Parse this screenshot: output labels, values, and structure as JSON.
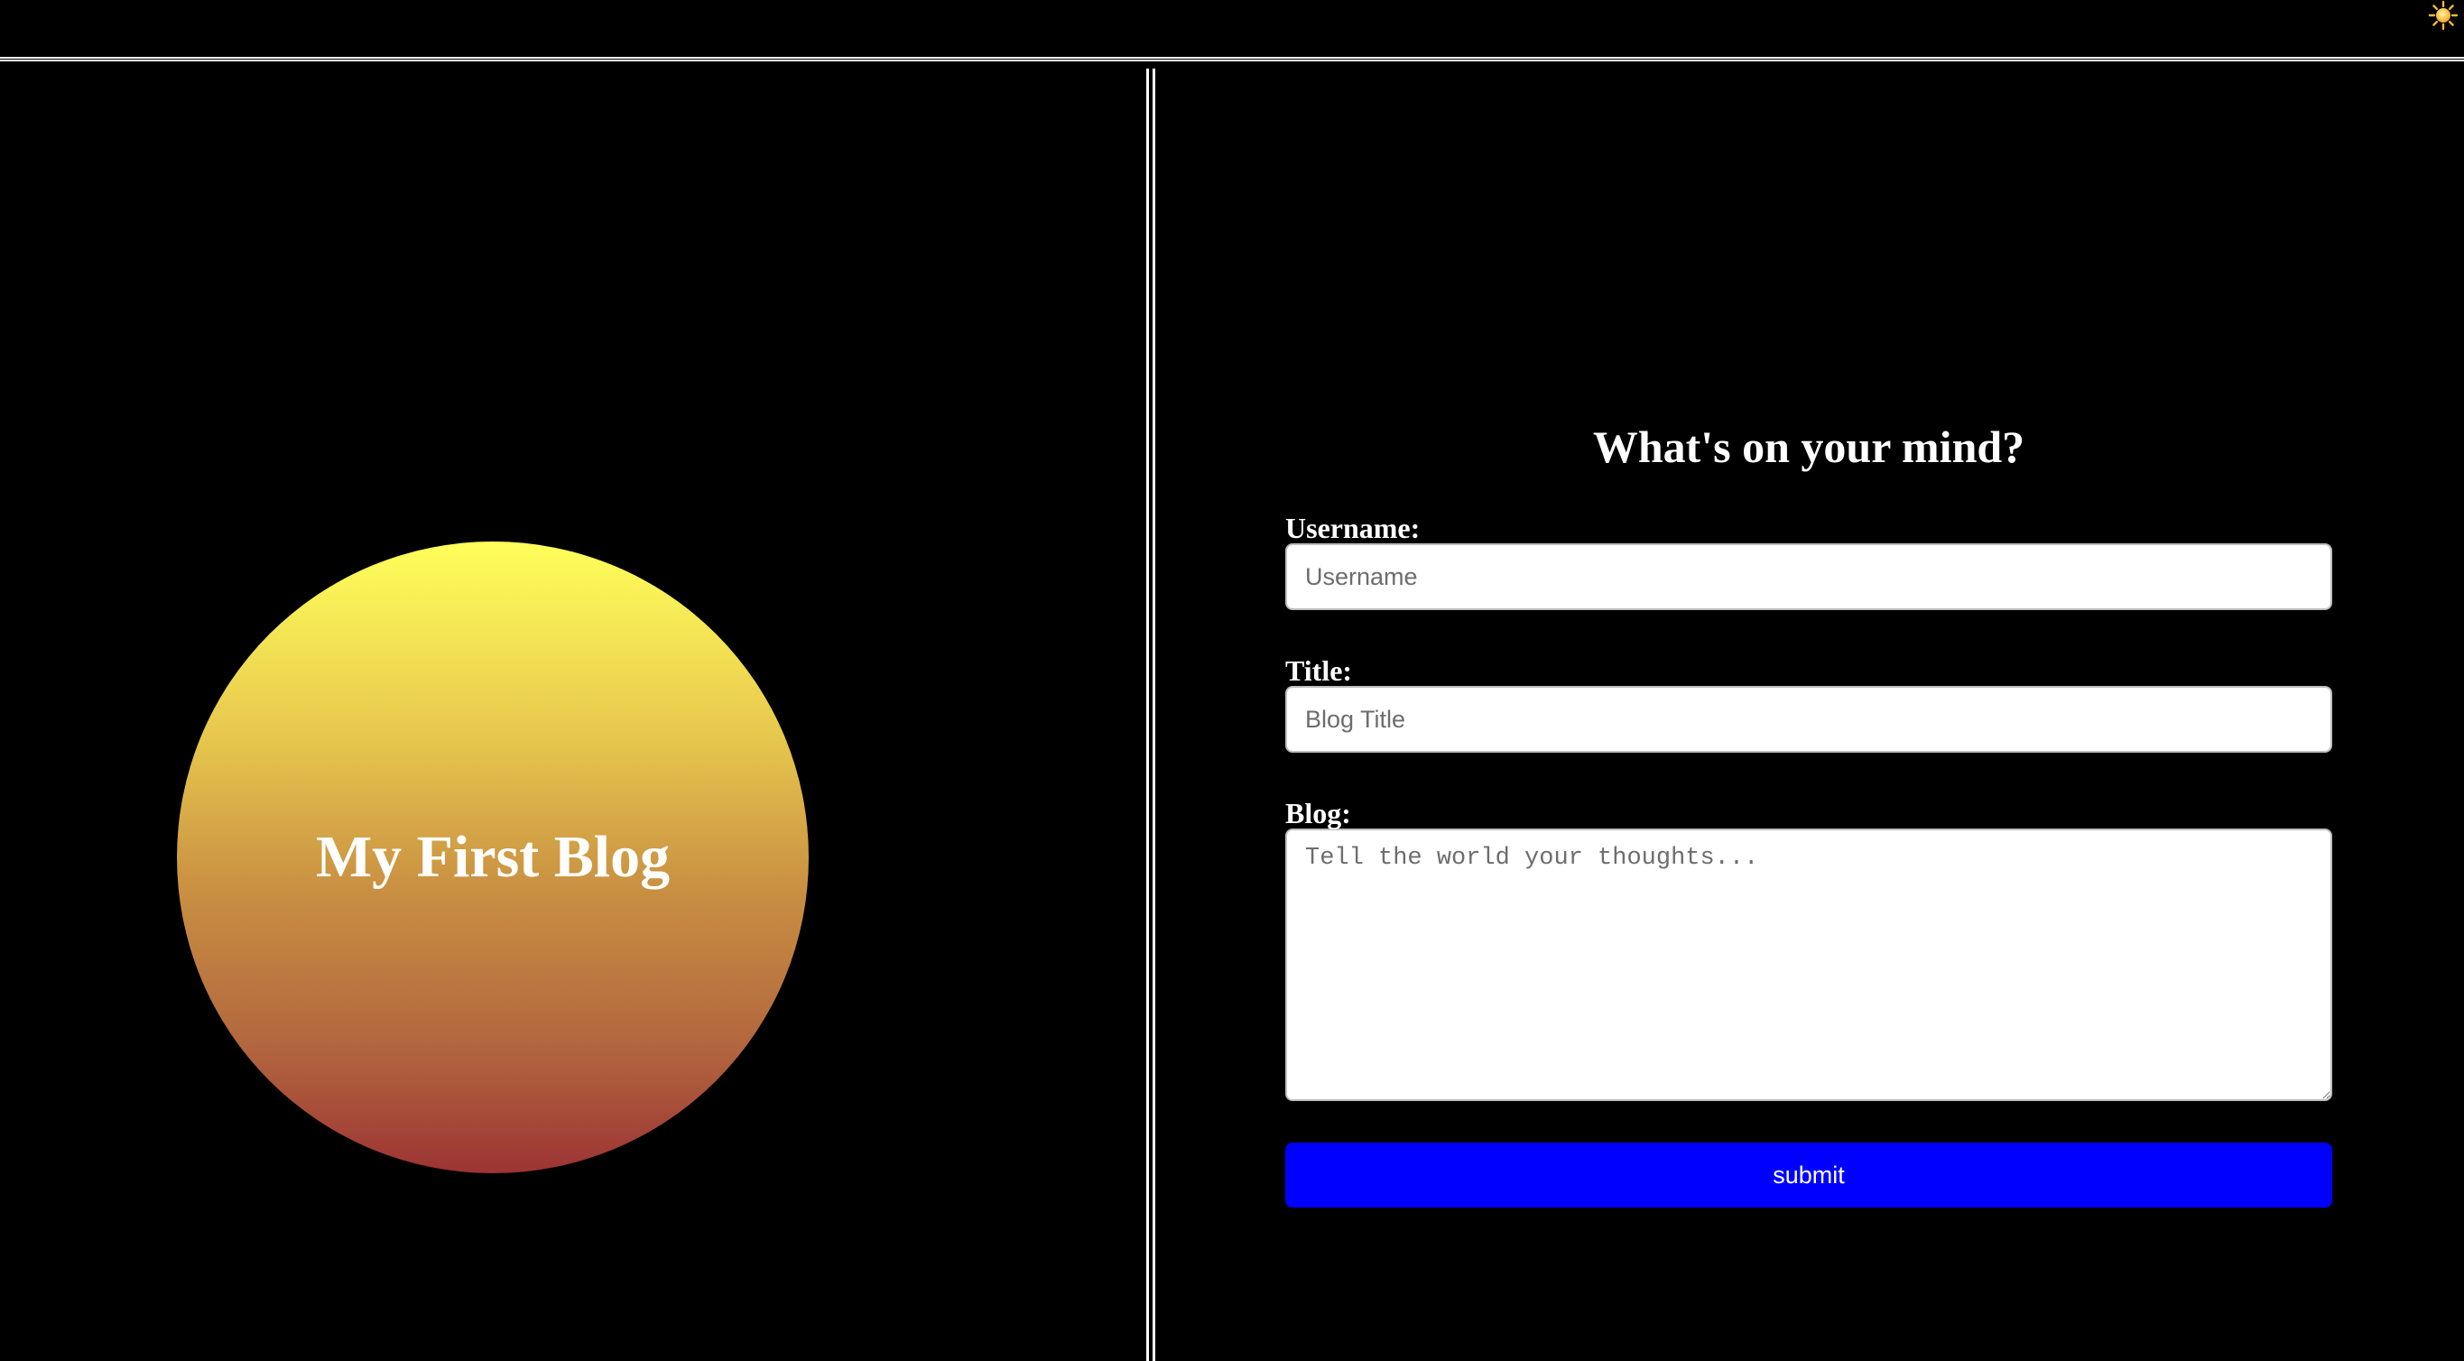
{
  "header": {
    "theme_toggle_icon": "sun-icon"
  },
  "hero": {
    "title": "My First Blog"
  },
  "form": {
    "title": "What's on your mind?",
    "username": {
      "label": "Username:",
      "placeholder": "Username",
      "value": ""
    },
    "blog_title": {
      "label": "Title:",
      "placeholder": "Blog Title",
      "value": ""
    },
    "blog_body": {
      "label": "Blog:",
      "placeholder": "Tell the world your thoughts...",
      "value": ""
    },
    "submit_label": "submit"
  },
  "colors": {
    "background": "#000000",
    "text": "#ffffff",
    "submit_button": "#0000ff",
    "circle_gradient_top": "#ffff5a",
    "circle_gradient_bottom": "#9c3434"
  }
}
